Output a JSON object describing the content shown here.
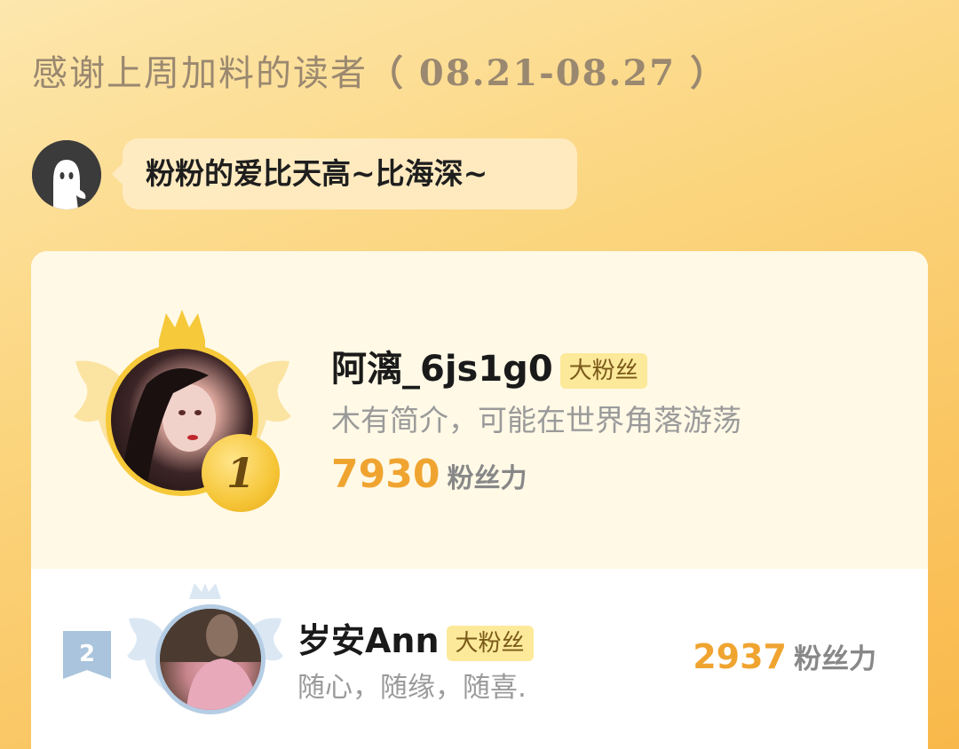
{
  "header": {
    "title": "感谢上周加料的读者",
    "date_range": "（ 08.21-08.27 ）"
  },
  "message": {
    "avatar_icon": "ghost-icon",
    "text": "粉粉的爱比天高~比海深~"
  },
  "ranking": [
    {
      "rank": "1",
      "name": "阿漓_6js1g0",
      "badge": "大粉丝",
      "bio": "木有简介，可能在世界角落游荡",
      "score": "7930",
      "score_unit": "粉丝力"
    },
    {
      "rank": "2",
      "name": "岁安Ann",
      "badge": "大粉丝",
      "bio": "随心，随缘，随喜.",
      "score": "2937",
      "score_unit": "粉丝力"
    }
  ],
  "colors": {
    "gold": "#f6c93a",
    "silver": "#b5cde4",
    "score": "#f0a430",
    "badge_bg": "#fde99a"
  }
}
